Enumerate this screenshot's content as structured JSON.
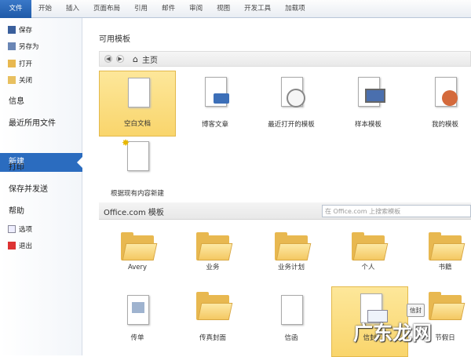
{
  "tabs": [
    "文件",
    "开始",
    "插入",
    "页面布局",
    "引用",
    "邮件",
    "审阅",
    "视图",
    "开发工具",
    "加载项"
  ],
  "sidebar": {
    "save": "保存",
    "save_as": "另存为",
    "open": "打开",
    "close": "关闭",
    "info": "信息",
    "recent": "最近所用文件",
    "new": "新建",
    "print": "打印",
    "save_send": "保存并发送",
    "help": "帮助",
    "options": "选项",
    "exit": "退出"
  },
  "main": {
    "available_title": "可用模板",
    "nav_home": "主页",
    "templates": [
      "空白文档",
      "博客文章",
      "最近打开的模板",
      "样本模板",
      "我的模板"
    ],
    "from_existing": "根据现有内容新建",
    "office_title": "Office.com 模板",
    "search_placeholder": "在 Office.com 上搜索模板",
    "folders": [
      "Avery",
      "业务",
      "业务计划",
      "个人",
      "书籍"
    ],
    "row4": [
      "传单",
      "传真封面",
      "信函",
      "信封",
      "节假日"
    ],
    "tooltip": "信封"
  },
  "watermark": "广东龙网",
  "colors": {
    "accent": "#2b6cbf",
    "highlight": "#f9d56c"
  }
}
